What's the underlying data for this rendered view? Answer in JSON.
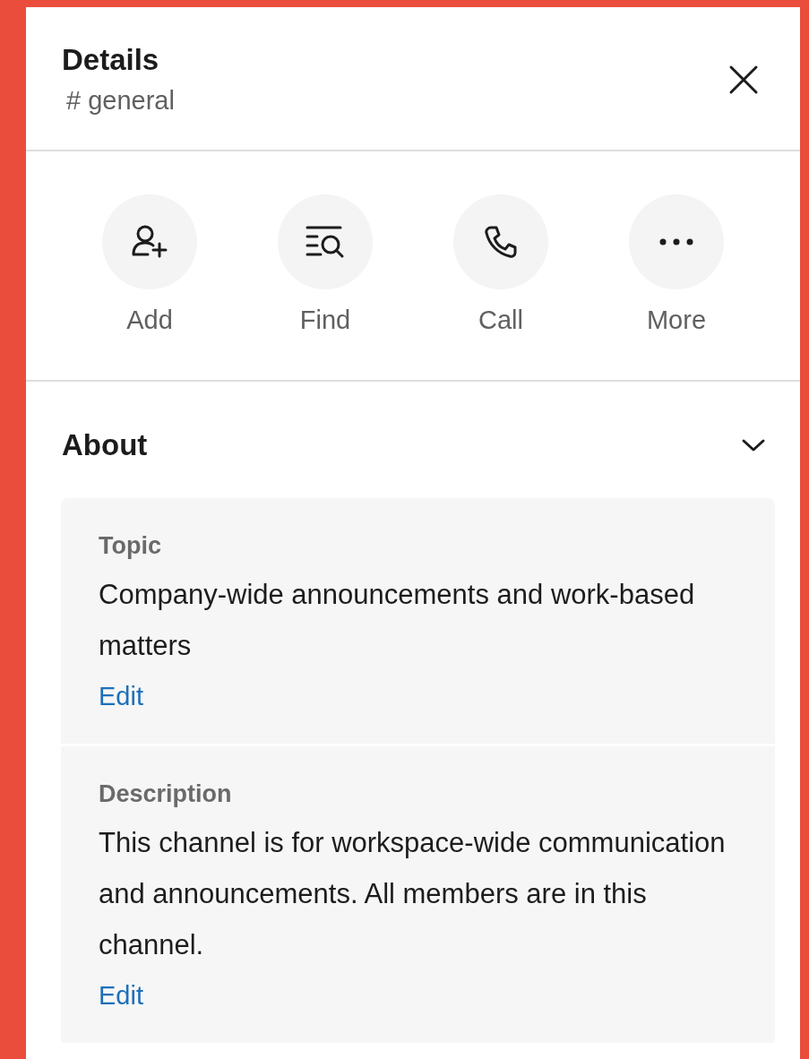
{
  "header": {
    "title": "Details",
    "channel": "# general"
  },
  "actions": [
    {
      "kind": "add",
      "label": "Add"
    },
    {
      "kind": "find",
      "label": "Find"
    },
    {
      "kind": "call",
      "label": "Call"
    },
    {
      "kind": "more",
      "label": "More"
    }
  ],
  "about": {
    "title": "About",
    "expanded": true,
    "sections": [
      {
        "label": "Topic",
        "text": "Company-wide announcements and work-based matters",
        "link": "Edit"
      },
      {
        "label": "Description",
        "text": "This channel is for workspace-wide communication and announcements. All members are in this channel.",
        "link": "Edit"
      }
    ]
  }
}
